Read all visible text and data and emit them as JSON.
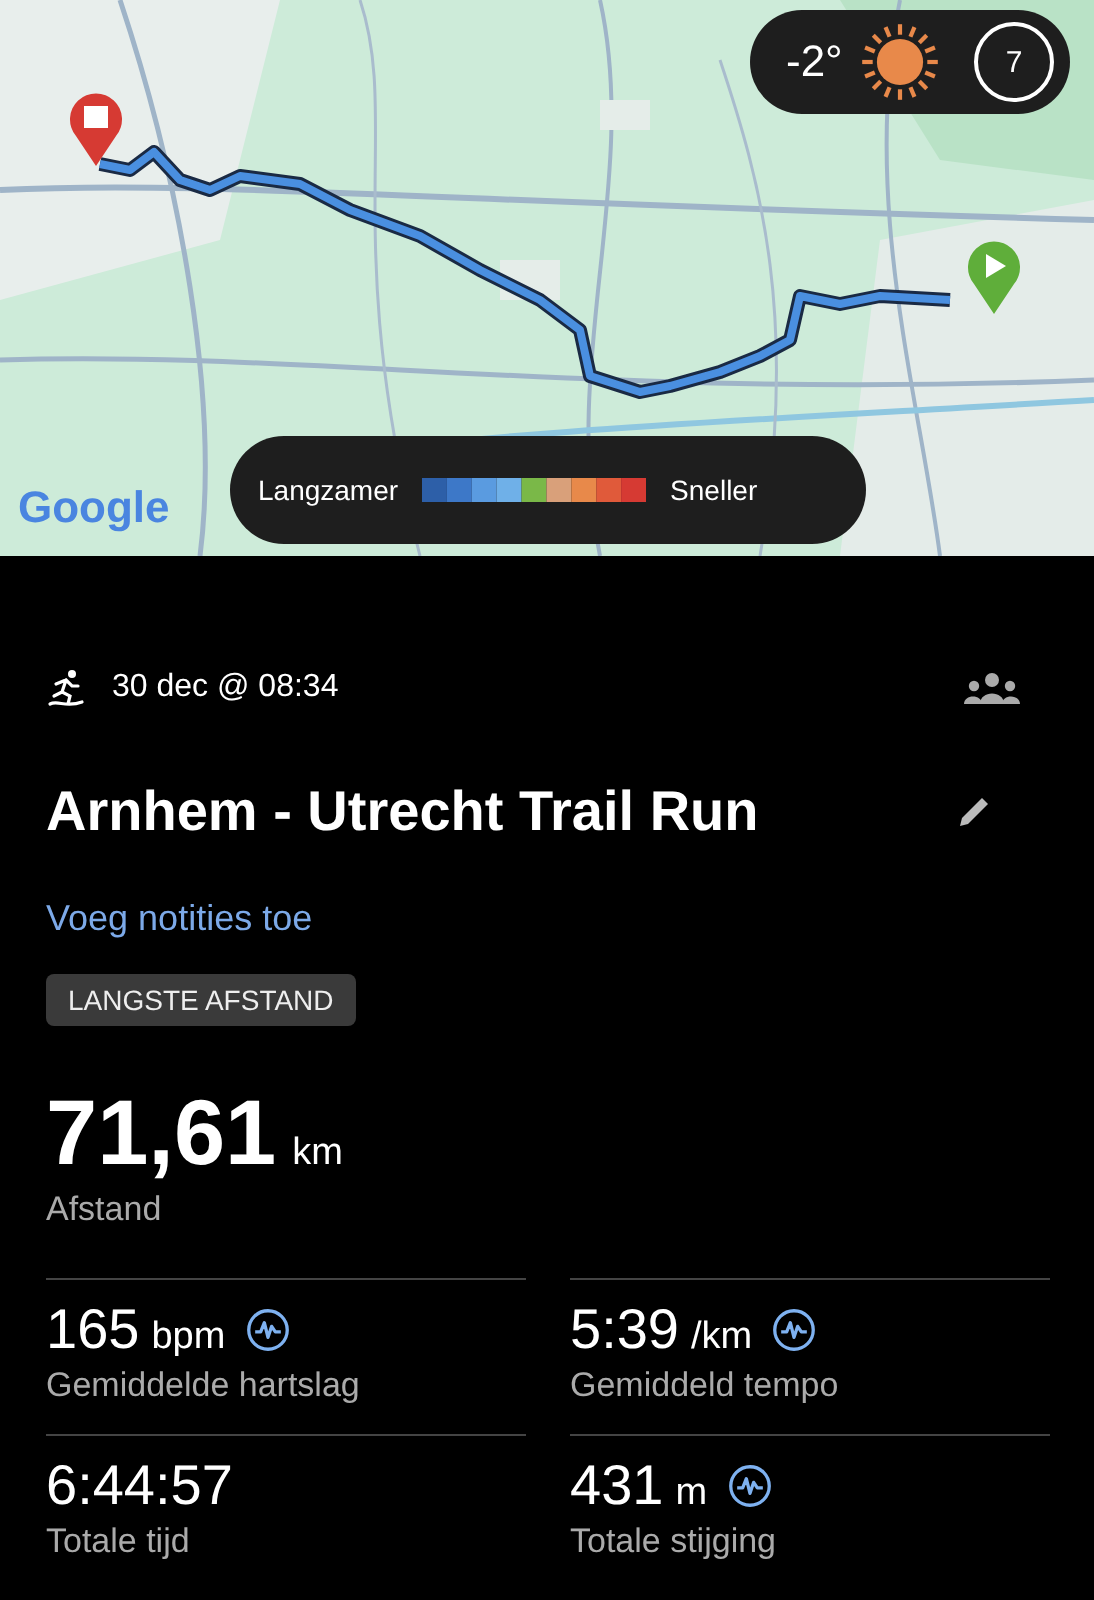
{
  "map": {
    "weather": {
      "temperature": "-2°",
      "index": "7"
    },
    "legend": {
      "slow_label": "Langzamer",
      "fast_label": "Sneller"
    },
    "attribution": "Google"
  },
  "activity": {
    "date": "30 dec @ 08:34",
    "title": "Arnhem - Utrecht Trail Run",
    "notes_link": "Voeg notities toe",
    "badge": "LANGSTE AFSTAND"
  },
  "distance": {
    "value": "71,61",
    "unit": "km",
    "label": "Afstand"
  },
  "stats": [
    {
      "value": "165",
      "unit": "bpm",
      "label": "Gemiddelde hartslag",
      "chart_link": true
    },
    {
      "value": "5:39",
      "unit": "/km",
      "label": "Gemiddeld tempo",
      "chart_link": true
    },
    {
      "value": "6:44:57",
      "label": "Totale tijd",
      "chart_link": false
    },
    {
      "value": "431",
      "unit": "m",
      "label": "Totale stijging",
      "chart_link": true
    }
  ]
}
